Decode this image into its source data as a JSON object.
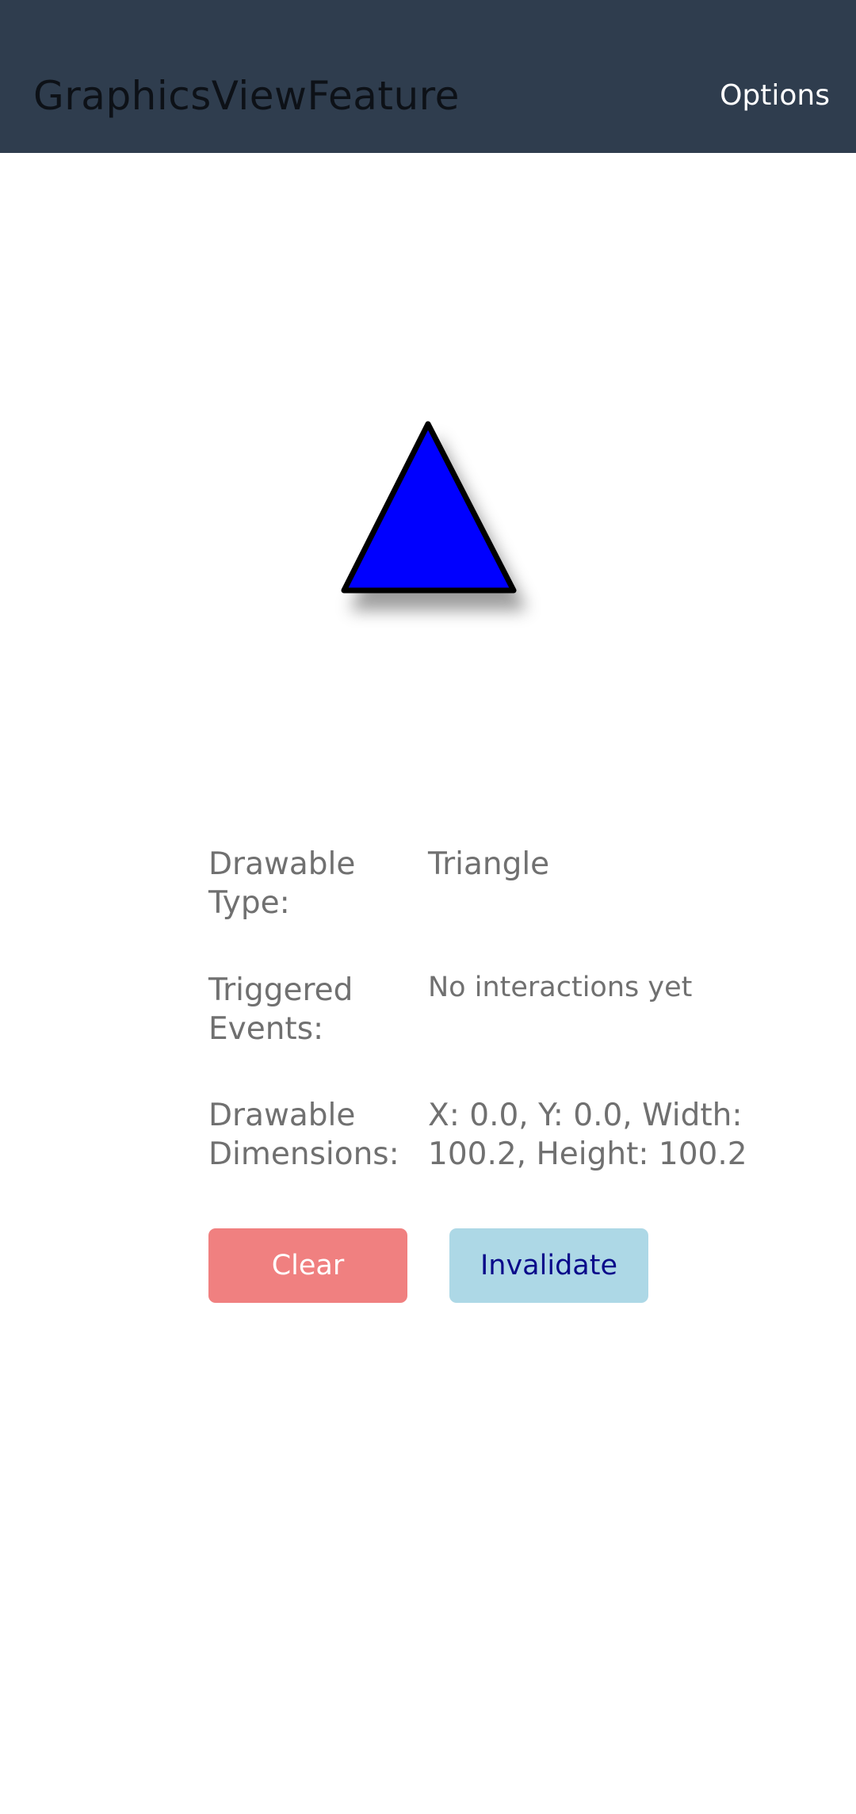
{
  "app_bar": {
    "title": "GraphicsViewFeature",
    "options_label": "Options",
    "background": "#2f3d4e"
  },
  "drawable": {
    "shape": "triangle",
    "fill": "#0000ff",
    "stroke": "#000000"
  },
  "info": {
    "type_label": "Drawable Type:",
    "type_value": "Triangle",
    "events_label": "Triggered Events:",
    "events_value": "No interactions yet",
    "dimensions_label": "Drawable Dimensions:",
    "dimensions_value": "X: 0.0, Y: 0.0, Width: 100.2, Height: 100.2"
  },
  "buttons": {
    "clear_label": "Clear",
    "clear_color": "#f08080",
    "invalidate_label": "Invalidate",
    "invalidate_color": "#add8e6"
  }
}
